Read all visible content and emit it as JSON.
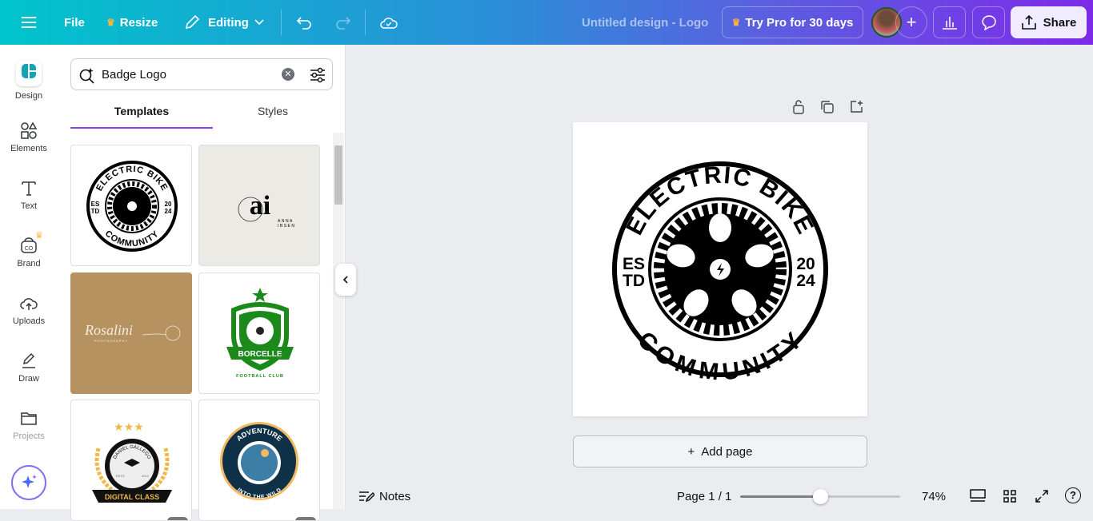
{
  "topbar": {
    "file": "File",
    "resize": "Resize",
    "editing": "Editing",
    "title": "Untitled design - Logo",
    "try_pro": "Try Pro for 30 days",
    "share": "Share"
  },
  "rail": {
    "items": [
      {
        "label": "Design"
      },
      {
        "label": "Elements"
      },
      {
        "label": "Text"
      },
      {
        "label": "Brand"
      },
      {
        "label": "Uploads"
      },
      {
        "label": "Draw"
      },
      {
        "label": "Projects"
      }
    ]
  },
  "panel": {
    "search_value": "Badge Logo",
    "tabs": [
      {
        "label": "Templates"
      },
      {
        "label": "Styles"
      }
    ],
    "templates": [
      {
        "name": "electric-bike",
        "top": "ELECTRIC BIKE",
        "bottom": "COMMUNITY",
        "left1": "ES",
        "left2": "TD",
        "right1": "20",
        "right2": "24"
      },
      {
        "name": "anna-ibsen",
        "mark": "ai",
        "line1": "ANNA",
        "line2": "IBSEN"
      },
      {
        "name": "rosalini",
        "mark": "Rosalini",
        "sub": "PHOTOGRAPHY"
      },
      {
        "name": "borcelle",
        "banner": "BORCELLE",
        "sub": "FOOTBALL CLUB"
      },
      {
        "name": "digital-class",
        "arc": "DANIEL GALLEGO",
        "banner": "DIGITAL CLASS",
        "left": "ESTD",
        "right": "2012"
      },
      {
        "name": "adventure",
        "top": "ADVENTURE",
        "bottom": "INTO THE WILD"
      }
    ]
  },
  "canvas": {
    "logo_top": "ELECTRIC BIKE",
    "logo_bottom": "COMMUNITY",
    "left1": "ES",
    "left2": "TD",
    "right1": "20",
    "right2": "24",
    "add_page": "Add page"
  },
  "bottom": {
    "notes": "Notes",
    "page": "Page 1 / 1",
    "zoom": "74%",
    "zoom_fraction": 0.5
  },
  "colors": {
    "accent": "#8b3dff",
    "crown": "#ffb43f"
  }
}
